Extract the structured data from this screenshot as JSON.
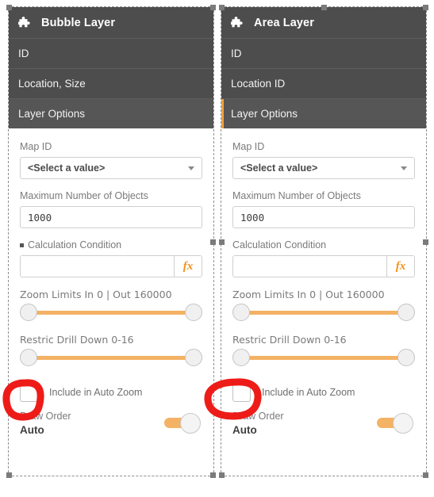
{
  "panels": [
    {
      "title": "Bubble Layer",
      "icon": "puzzle-icon",
      "tabs": [
        {
          "label": "ID",
          "selected": false
        },
        {
          "label": "Location, Size",
          "selected": false
        },
        {
          "label": "Layer Options",
          "selected": true,
          "accent": false
        }
      ],
      "map_id": {
        "label": "Map ID",
        "value": "<Select a value>",
        "caret": "chevron-down-icon"
      },
      "max_objects": {
        "label": "Maximum Number of Objects",
        "value": "1000"
      },
      "calc_condition": {
        "label": "Calculation Condition",
        "value": "",
        "bullet": true,
        "fx_label": "fx"
      },
      "zoom_limits": {
        "label": "Zoom Limits In 0 | Out 160000"
      },
      "drill_down": {
        "label": "Restric Drill Down 0-16"
      },
      "auto_zoom": {
        "label": "Include in Auto Zoom",
        "checked": false
      },
      "draw_order": {
        "label": "Draw Order",
        "value": "Auto",
        "toggle_on": true
      }
    },
    {
      "title": "Area Layer",
      "icon": "puzzle-icon",
      "tabs": [
        {
          "label": "ID",
          "selected": false
        },
        {
          "label": "Location ID",
          "selected": false
        },
        {
          "label": "Layer Options",
          "selected": true,
          "accent": true
        }
      ],
      "map_id": {
        "label": "Map ID",
        "value": "<Select a value>",
        "caret": "chevron-down-icon"
      },
      "max_objects": {
        "label": "Maximum Number of Objects",
        "value": "1000"
      },
      "calc_condition": {
        "label": "Calculation Condition",
        "value": "",
        "bullet": false,
        "fx_label": "fx"
      },
      "zoom_limits": {
        "label": "Zoom Limits In 0 | Out 160000"
      },
      "drill_down": {
        "label": "Restric Drill Down 0-16"
      },
      "auto_zoom": {
        "label": "Include in Auto Zoom",
        "checked": false
      },
      "draw_order": {
        "label": "Draw Order",
        "value": "Auto",
        "toggle_on": true
      }
    }
  ],
  "colors": {
    "header_bg": "#4d4d4d",
    "header_selected_bg": "#565656",
    "accent_orange": "#f0a23c",
    "slider_track": "#f4b264",
    "fx_orange": "#f2921d",
    "annotation_red": "#ee1c18",
    "panel_border": "#8f8f8f",
    "label_gray": "#7a7a7a"
  },
  "annotations": [
    {
      "name": "highlight-left-auto-zoom-checkbox",
      "shape": "hand-drawn-oval"
    },
    {
      "name": "highlight-right-auto-zoom-checkbox",
      "shape": "hand-drawn-oval"
    }
  ]
}
